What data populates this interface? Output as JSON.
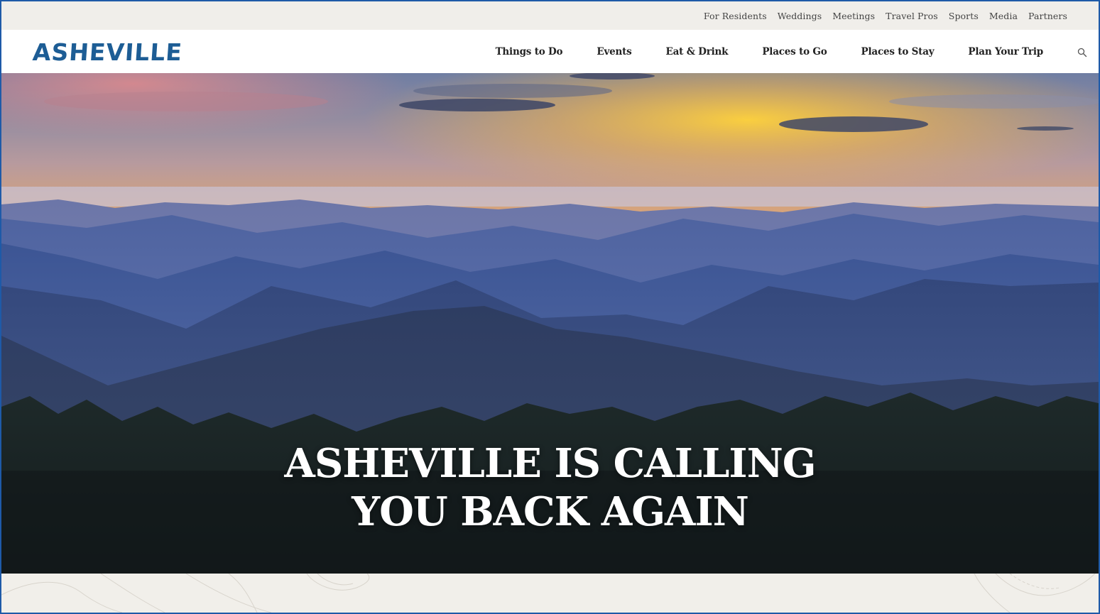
{
  "utility_nav": {
    "items": [
      "For Residents",
      "Weddings",
      "Meetings",
      "Travel Pros",
      "Sports",
      "Media",
      "Partners"
    ]
  },
  "brand": {
    "logo_text": "ASHEVILLE",
    "color": "#1d5d95"
  },
  "main_nav": {
    "items": [
      "Things to Do",
      "Events",
      "Eat & Drink",
      "Places to Go",
      "Places to Stay",
      "Plan Your Trip"
    ],
    "search_icon": "search-icon"
  },
  "hero": {
    "title_line1": "ASHEVILLE IS CALLING",
    "title_line2": "YOU BACK AGAIN"
  },
  "colors": {
    "utility_bg": "#f0eeea",
    "strip_bg": "#f1efea",
    "frame": "#1e5aa8"
  }
}
